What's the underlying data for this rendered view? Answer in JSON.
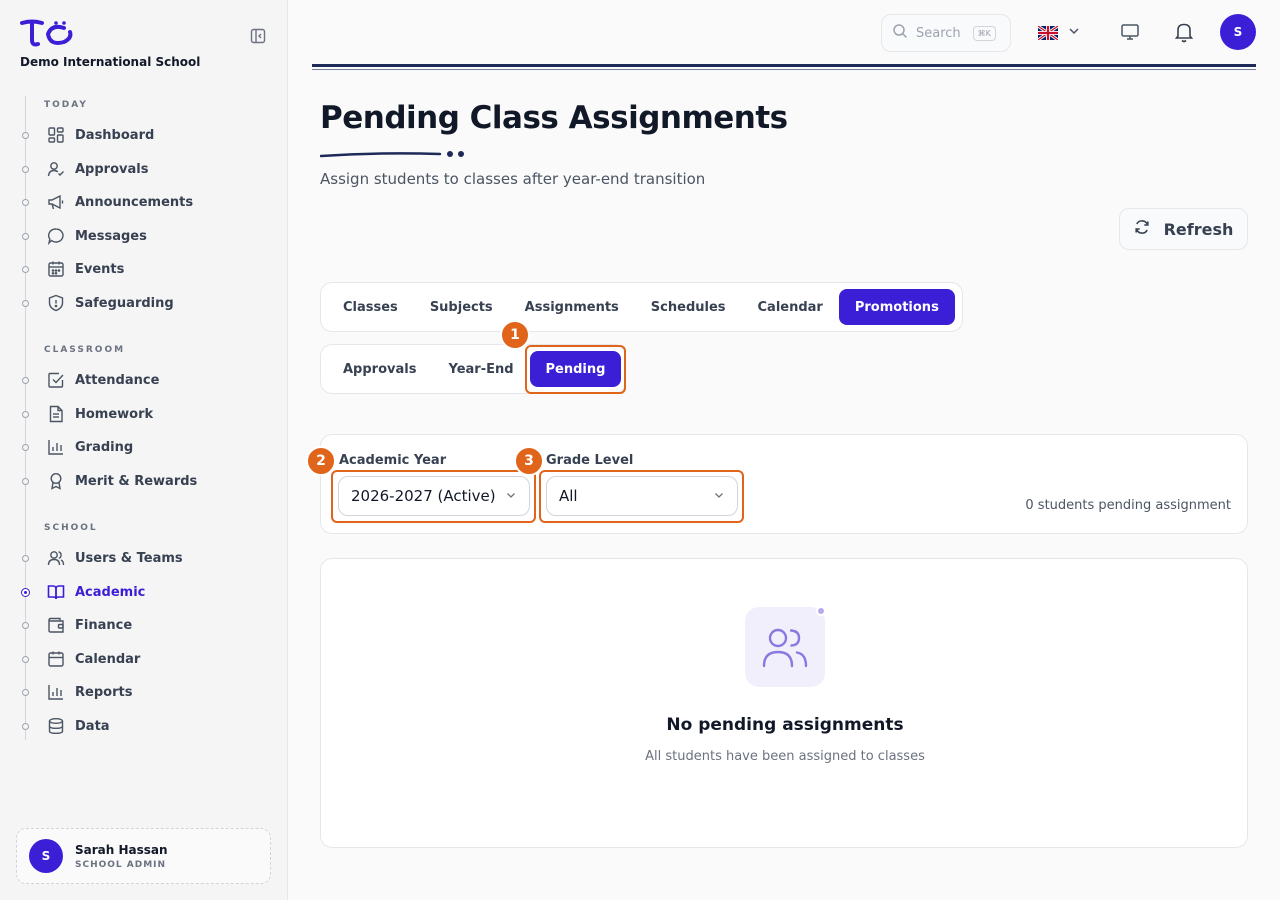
{
  "school": {
    "name": "Demo International School"
  },
  "sidebar": {
    "sections": [
      {
        "title": "TODAY",
        "items": [
          {
            "label": "Dashboard",
            "icon": "dashboard-icon"
          },
          {
            "label": "Approvals",
            "icon": "user-check-icon"
          },
          {
            "label": "Announcements",
            "icon": "megaphone-icon"
          },
          {
            "label": "Messages",
            "icon": "message-icon"
          },
          {
            "label": "Events",
            "icon": "calendar-grid-icon"
          },
          {
            "label": "Safeguarding",
            "icon": "shield-icon"
          }
        ]
      },
      {
        "title": "CLASSROOM",
        "items": [
          {
            "label": "Attendance",
            "icon": "checkbox-icon"
          },
          {
            "label": "Homework",
            "icon": "document-icon"
          },
          {
            "label": "Grading",
            "icon": "bar-chart-icon"
          },
          {
            "label": "Merit & Rewards",
            "icon": "award-icon"
          }
        ]
      },
      {
        "title": "SCHOOL",
        "items": [
          {
            "label": "Users & Teams",
            "icon": "users-icon"
          },
          {
            "label": "Academic",
            "icon": "book-icon",
            "active": true
          },
          {
            "label": "Finance",
            "icon": "wallet-icon"
          },
          {
            "label": "Calendar",
            "icon": "calendar-icon"
          },
          {
            "label": "Reports",
            "icon": "bar-chart-icon"
          },
          {
            "label": "Data",
            "icon": "database-icon"
          }
        ]
      }
    ],
    "user": {
      "initial": "S",
      "name": "Sarah Hassan",
      "role": "SCHOOL ADMIN"
    }
  },
  "topbar": {
    "search_placeholder": "Search",
    "search_shortcut": "⌘K",
    "avatar_initial": "S"
  },
  "header": {
    "title": "Pending Class Assignments",
    "subtitle": "Assign students to classes after year-end transition",
    "refresh_label": "Refresh"
  },
  "tabs": {
    "main": [
      "Classes",
      "Subjects",
      "Assignments",
      "Schedules",
      "Calendar",
      "Promotions"
    ],
    "main_active": "Promotions",
    "sub": [
      "Approvals",
      "Year-End",
      "Pending"
    ],
    "sub_active": "Pending"
  },
  "annotations": [
    "1",
    "2",
    "3"
  ],
  "filters": {
    "academic_year_label": "Academic Year",
    "academic_year_value": "2026-2027 (Active)",
    "grade_level_label": "Grade Level",
    "grade_level_value": "All",
    "pending_count_text": "0 students pending assignment"
  },
  "empty_state": {
    "title": "No pending assignments",
    "subtitle": "All students have been assigned to classes"
  },
  "colors": {
    "primary": "#3b1fd6",
    "annotation": "#e0641a",
    "navy": "#1e2a5a"
  }
}
